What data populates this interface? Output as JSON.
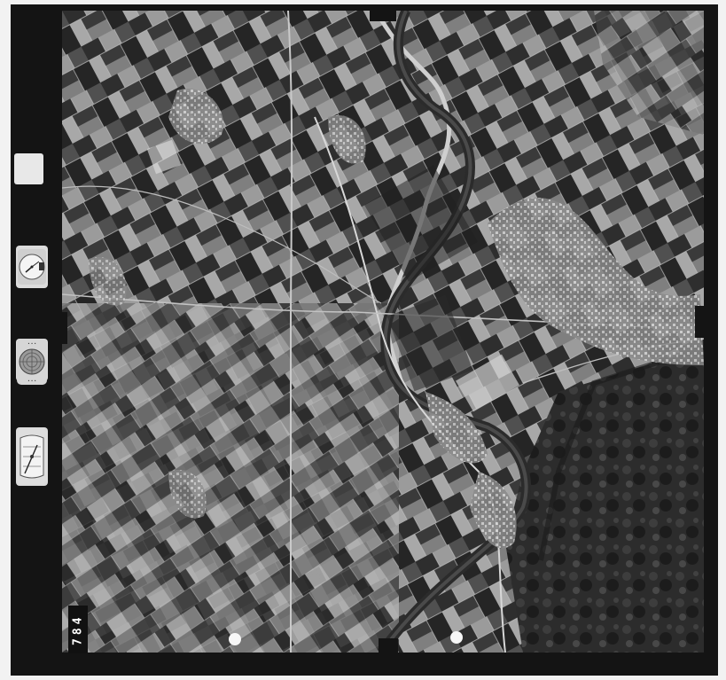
{
  "image": {
    "kind": "aerial survey photograph (black and white)",
    "frame_number": "784",
    "margin_card_text": "",
    "instruments": [
      {
        "name": "clock-icon"
      },
      {
        "name": "altimeter-icon"
      },
      {
        "name": "level-gauge-icon"
      }
    ]
  }
}
